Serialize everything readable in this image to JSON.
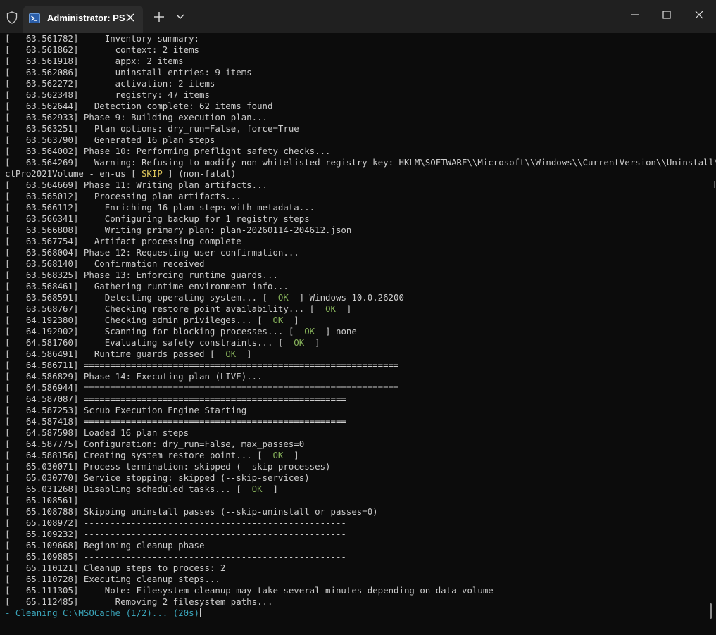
{
  "titlebar": {
    "tab_title": "Administrator: PS",
    "icons": {
      "shield": "shield-icon",
      "tab": "powershell-icon",
      "close": "close-icon",
      "new_tab": "plus-icon",
      "dropdown": "chevron-down-icon",
      "minimize": "minimize-icon",
      "maximize": "maximize-icon",
      "window_close": "close-icon"
    }
  },
  "colors": {
    "background": "#0c0c0c",
    "titlebar": "#202020",
    "tab_active": "#2c2c2c",
    "text": "#cccccc",
    "ok": "#86b15a",
    "skip": "#e0c85c",
    "spinner": "#3aa3b8"
  },
  "terminal": {
    "lines": [
      {
        "segments": [
          {
            "text": "[   63.561782]     Inventory summary:"
          }
        ]
      },
      {
        "segments": [
          {
            "text": "[   63.561862]       context: 2 items"
          }
        ]
      },
      {
        "segments": [
          {
            "text": "[   63.561918]       appx: 2 items"
          }
        ]
      },
      {
        "segments": [
          {
            "text": "[   63.562086]       uninstall_entries: 9 items"
          }
        ]
      },
      {
        "segments": [
          {
            "text": "[   63.562272]       activation: 2 items"
          }
        ]
      },
      {
        "segments": [
          {
            "text": "[   63.562348]       registry: 47 items"
          }
        ]
      },
      {
        "segments": [
          {
            "text": "[   63.562644]   Detection complete: 62 items found"
          }
        ]
      },
      {
        "segments": [
          {
            "text": "[   63.562933] Phase 9: Building execution plan..."
          }
        ]
      },
      {
        "segments": [
          {
            "text": "[   63.563251]   Plan options: dry_run=False, force=True"
          }
        ]
      },
      {
        "segments": [
          {
            "text": "[   63.563790]   Generated 16 plan steps"
          }
        ]
      },
      {
        "segments": [
          {
            "text": "[   63.564002] Phase 10: Performing preflight safety checks..."
          }
        ]
      },
      {
        "segments": [
          {
            "text": "[   63.564269]   Warning: Refusing to modify non-whitelisted registry key: HKLM\\SOFTWARE\\\\Microsoft\\\\Windows\\\\CurrentVersion\\\\Uninstall\\Proje"
          }
        ]
      },
      {
        "segments": [
          {
            "text": "ctPro2021Volume - en-us [ "
          },
          {
            "text": "SKIP",
            "cls": "skip"
          },
          {
            "text": " ] (non-fatal)"
          }
        ]
      },
      {
        "segments": [
          {
            "text": "[   63.564669] Phase 11: Writing plan artifacts..."
          }
        ]
      },
      {
        "segments": [
          {
            "text": "[   63.565012]   Processing plan artifacts..."
          }
        ]
      },
      {
        "segments": [
          {
            "text": "[   63.566112]     Enriching 16 plan steps with metadata..."
          }
        ]
      },
      {
        "segments": [
          {
            "text": "[   63.566341]     Configuring backup for 1 registry steps"
          }
        ]
      },
      {
        "segments": [
          {
            "text": "[   63.566808]     Writing primary plan: plan-20260114-204612.json"
          }
        ]
      },
      {
        "segments": [
          {
            "text": "[   63.567754]   Artifact processing complete"
          }
        ]
      },
      {
        "segments": [
          {
            "text": "[   63.568004] Phase 12: Requesting user confirmation..."
          }
        ]
      },
      {
        "segments": [
          {
            "text": "[   63.568140]   Confirmation received"
          }
        ]
      },
      {
        "segments": [
          {
            "text": "[   63.568325] Phase 13: Enforcing runtime guards..."
          }
        ]
      },
      {
        "segments": [
          {
            "text": "[   63.568461]   Gathering runtime environment info..."
          }
        ]
      },
      {
        "segments": [
          {
            "text": "[   63.568591]     Detecting operating system... [  "
          },
          {
            "text": "OK",
            "cls": "ok"
          },
          {
            "text": "  ] Windows 10.0.26200"
          }
        ]
      },
      {
        "segments": [
          {
            "text": "[   63.568767]     Checking restore point availability... [  "
          },
          {
            "text": "OK",
            "cls": "ok"
          },
          {
            "text": "  ]"
          }
        ]
      },
      {
        "segments": [
          {
            "text": "[   64.192380]     Checking admin privileges... [  "
          },
          {
            "text": "OK",
            "cls": "ok"
          },
          {
            "text": "  ]"
          }
        ]
      },
      {
        "segments": [
          {
            "text": "[   64.192902]     Scanning for blocking processes... [  "
          },
          {
            "text": "OK",
            "cls": "ok"
          },
          {
            "text": "  ] none"
          }
        ]
      },
      {
        "segments": [
          {
            "text": "[   64.581760]     Evaluating safety constraints... [  "
          },
          {
            "text": "OK",
            "cls": "ok"
          },
          {
            "text": "  ]"
          }
        ]
      },
      {
        "segments": [
          {
            "text": "[   64.586491]   Runtime guards passed [  "
          },
          {
            "text": "OK",
            "cls": "ok"
          },
          {
            "text": "  ]"
          }
        ]
      },
      {
        "segments": [
          {
            "text": "[   64.586711] ============================================================"
          }
        ]
      },
      {
        "segments": [
          {
            "text": "[   64.586829] Phase 14: Executing plan (LIVE)..."
          }
        ]
      },
      {
        "segments": [
          {
            "text": "[   64.586944] ============================================================"
          }
        ]
      },
      {
        "segments": [
          {
            "text": "[   64.587087] =================================================="
          }
        ]
      },
      {
        "segments": [
          {
            "text": "[   64.587253] Scrub Execution Engine Starting"
          }
        ]
      },
      {
        "segments": [
          {
            "text": "[   64.587418] =================================================="
          }
        ]
      },
      {
        "segments": [
          {
            "text": "[   64.587598] Loaded 16 plan steps"
          }
        ]
      },
      {
        "segments": [
          {
            "text": "[   64.587775] Configuration: dry_run=False, max_passes=0"
          }
        ]
      },
      {
        "segments": [
          {
            "text": "[   64.588156] Creating system restore point... [  "
          },
          {
            "text": "OK",
            "cls": "ok"
          },
          {
            "text": "  ]"
          }
        ]
      },
      {
        "segments": [
          {
            "text": "[   65.030071] Process termination: skipped (--skip-processes)"
          }
        ]
      },
      {
        "segments": [
          {
            "text": "[   65.030770] Service stopping: skipped (--skip-services)"
          }
        ]
      },
      {
        "segments": [
          {
            "text": "[   65.031268] Disabling scheduled tasks... [  "
          },
          {
            "text": "OK",
            "cls": "ok"
          },
          {
            "text": "  ]"
          }
        ]
      },
      {
        "segments": [
          {
            "text": "[   65.108561] --------------------------------------------------"
          }
        ]
      },
      {
        "segments": [
          {
            "text": "[   65.108788] Skipping uninstall passes (--skip-uninstall or passes=0)"
          }
        ]
      },
      {
        "segments": [
          {
            "text": "[   65.108972] --------------------------------------------------"
          }
        ]
      },
      {
        "segments": [
          {
            "text": "[   65.109232] --------------------------------------------------"
          }
        ]
      },
      {
        "segments": [
          {
            "text": "[   65.109668] Beginning cleanup phase"
          }
        ]
      },
      {
        "segments": [
          {
            "text": "[   65.109885] --------------------------------------------------"
          }
        ]
      },
      {
        "segments": [
          {
            "text": "[   65.110121] Cleanup steps to process: 2"
          }
        ]
      },
      {
        "segments": [
          {
            "text": "[   65.110728] Executing cleanup steps..."
          }
        ]
      },
      {
        "segments": [
          {
            "text": "[   65.111305]     Note: Filesystem cleanup may take several minutes depending on data volume"
          }
        ]
      },
      {
        "segments": [
          {
            "text": "[   65.112485]       Removing 2 filesystem paths..."
          }
        ]
      }
    ],
    "status_line": "- Cleaning C:\\MSOCache (1/2)... (20s)"
  }
}
